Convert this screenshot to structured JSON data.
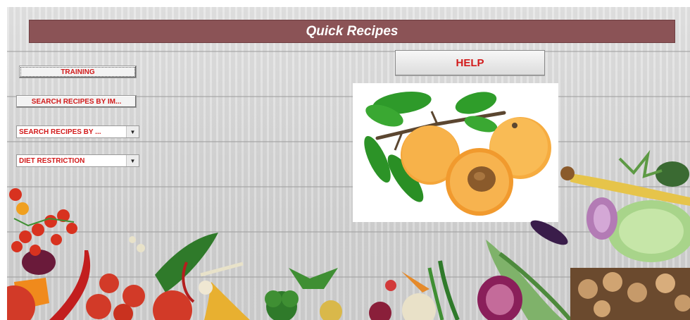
{
  "app": {
    "title": "Quick Recipes"
  },
  "buttons": {
    "training": "TRAINING",
    "search_by_image": "SEARCH RECIPES BY IM...",
    "help": "HELP"
  },
  "dropdowns": {
    "search_recipes": "SEARCH RECIPES BY ...",
    "diet_restriction": "DIET RESTRICTION"
  },
  "icons": {
    "dropdown_arrow": "chevron-down-icon",
    "photo": "apricot-image",
    "decor": "vegetables-border"
  },
  "colors": {
    "title_bar": "#8b5356",
    "button_text": "#d21a1a"
  }
}
